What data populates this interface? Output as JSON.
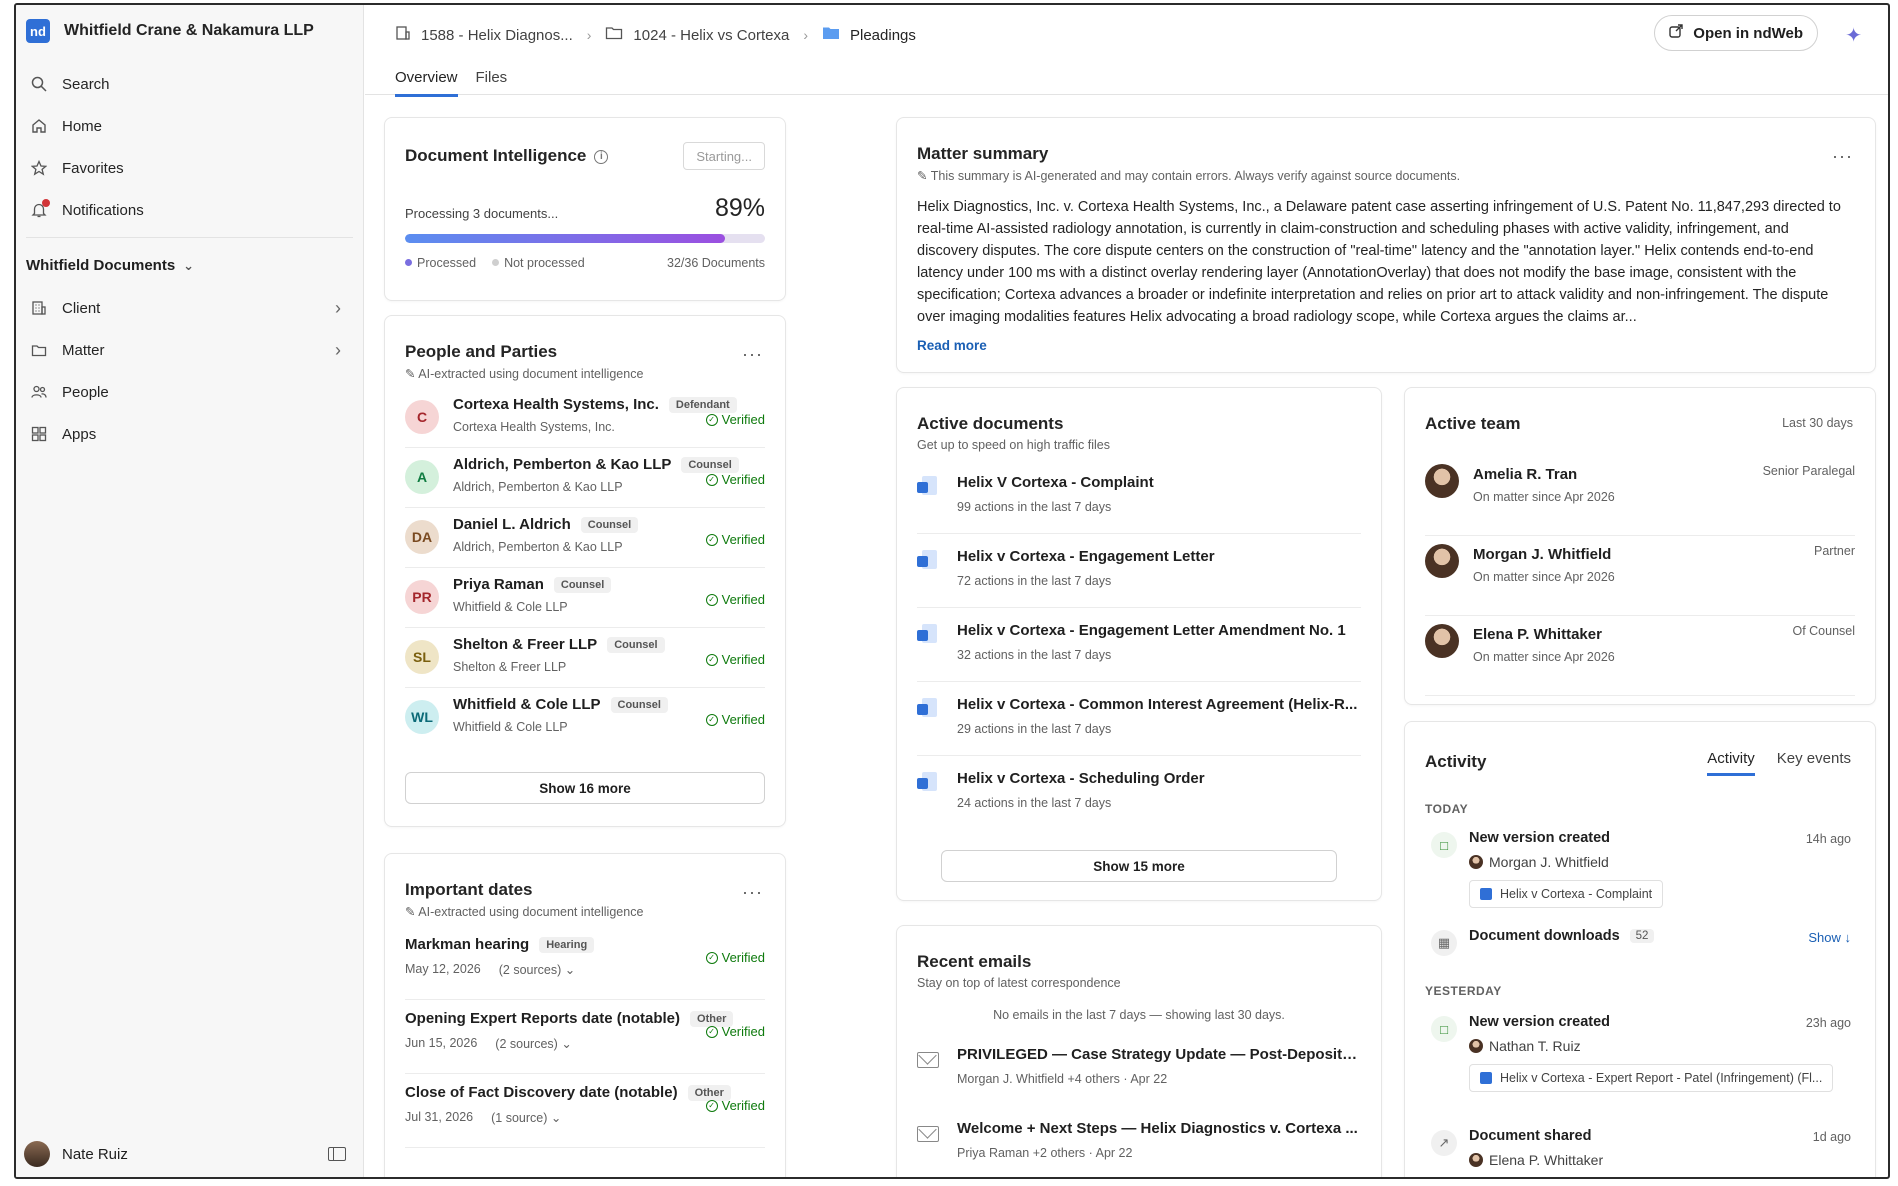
{
  "brand": {
    "logo_text": "nd",
    "name": "Whitfield Crane & Nakamura LLP"
  },
  "sidebar": {
    "items": [
      {
        "label": "Search",
        "icon": "search-icon"
      },
      {
        "label": "Home",
        "icon": "home-icon"
      },
      {
        "label": "Favorites",
        "icon": "star-icon"
      },
      {
        "label": "Notifications",
        "icon": "bell-icon"
      }
    ],
    "section_title": "Whitfield Documents",
    "section_items": [
      {
        "label": "Client",
        "icon": "building-icon"
      },
      {
        "label": "Matter",
        "icon": "folder-icon"
      },
      {
        "label": "People",
        "icon": "people-icon"
      },
      {
        "label": "Apps",
        "icon": "apps-icon"
      }
    ],
    "user_name": "Nate Ruiz"
  },
  "header": {
    "breadcrumbs": [
      "1588 - Helix Diagnos...",
      "1024 - Helix vs Cortexa",
      "Pleadings"
    ],
    "open_button": "Open in ndWeb",
    "tabs": [
      "Overview",
      "Files"
    ]
  },
  "doc_intel": {
    "title": "Document Intelligence",
    "status_button": "Starting...",
    "processing_text": "Processing 3 documents...",
    "percent_text": "89%",
    "progress": 0.89,
    "legend_processed": "Processed",
    "legend_not_processed": "Not processed",
    "count_text": "32/36 Documents",
    "colors": {
      "bar_start": "#5b8ef0",
      "bar_end": "#9b4fe0"
    }
  },
  "people": {
    "title": "People and Parties",
    "subtitle": "AI-extracted using document intelligence",
    "verified_label": "Verified",
    "rows": [
      {
        "initials": "C",
        "name": "Cortexa Health Systems, Inc.",
        "tag": "Defendant",
        "org": "Cortexa Health Systems, Inc.",
        "bg": "#f6d5d5",
        "fg": "#a4262c"
      },
      {
        "initials": "A",
        "name": "Aldrich, Pemberton & Kao LLP",
        "tag": "Counsel",
        "org": "Aldrich, Pemberton & Kao LLP",
        "bg": "#d4f0dc",
        "fg": "#107c41"
      },
      {
        "initials": "DA",
        "name": "Daniel L. Aldrich",
        "tag": "Counsel",
        "org": "Aldrich, Pemberton & Kao LLP",
        "bg": "#ecdccd",
        "fg": "#7a4a21"
      },
      {
        "initials": "PR",
        "name": "Priya Raman",
        "tag": "Counsel",
        "org": "Whitfield & Cole LLP",
        "bg": "#f6d5d5",
        "fg": "#a4262c"
      },
      {
        "initials": "SL",
        "name": "Shelton & Freer LLP",
        "tag": "Counsel",
        "org": "Shelton & Freer LLP",
        "bg": "#efe5c6",
        "fg": "#7a5f0e"
      },
      {
        "initials": "WL",
        "name": "Whitfield & Cole LLP",
        "tag": "Counsel",
        "org": "Whitfield & Cole LLP",
        "bg": "#cdeef0",
        "fg": "#0b6a77"
      }
    ],
    "show_more": "Show 16 more"
  },
  "dates": {
    "title": "Important dates",
    "subtitle": "AI-extracted using document intelligence",
    "verified_label": "Verified",
    "rows": [
      {
        "name": "Markman hearing",
        "tag": "Hearing",
        "date": "May 12, 2026",
        "sources": "(2 sources)"
      },
      {
        "name": "Opening Expert Reports date (notable)",
        "tag": "Other",
        "date": "Jun 15, 2026",
        "sources": "(2 sources)"
      },
      {
        "name": "Close of Fact Discovery date (notable)",
        "tag": "Other",
        "date": "Jul 31, 2026",
        "sources": "(1 source)"
      }
    ]
  },
  "summary": {
    "title": "Matter summary",
    "disclaimer": "This summary is AI-generated and may contain errors. Always verify against source documents.",
    "text": "Helix Diagnostics, Inc. v. Cortexa Health Systems, Inc., a Delaware patent case asserting infringement of U.S. Patent No. 11,847,293 directed to real-time AI-assisted radiology annotation, is currently in claim-construction and scheduling phases with active validity, infringement, and discovery disputes. The core dispute centers on the construction of \"real-time\" latency and the \"annotation layer.\" Helix contends end-to-end latency under 100 ms with a distinct overlay rendering layer (AnnotationOverlay) that does not modify the base image, consistent with the specification; Cortexa advances a broader or indefinite interpretation and relies on prior art to attack validity and non-infringement. The dispute over imaging modalities features Helix advocating a broad radiology scope, while Cortexa argues the claims ar...",
    "read_more": "Read more"
  },
  "active_docs": {
    "title": "Active documents",
    "subtitle": "Get up to speed on high traffic files",
    "rows": [
      {
        "name": "Helix V Cortexa - Complaint",
        "meta": "99 actions in the last 7 days"
      },
      {
        "name": "Helix v Cortexa - Engagement Letter",
        "meta": "72 actions in the last 7 days"
      },
      {
        "name": "Helix v Cortexa - Engagement Letter Amendment No. 1",
        "meta": "32 actions in the last 7 days"
      },
      {
        "name": "Helix v Cortexa - Common Interest Agreement (Helix-R...",
        "meta": "29 actions in the last 7 days"
      },
      {
        "name": "Helix v Cortexa - Scheduling Order",
        "meta": "24 actions in the last 7 days"
      }
    ],
    "show_more": "Show 15 more"
  },
  "emails": {
    "title": "Recent emails",
    "subtitle": "Stay on top of latest correspondence",
    "notice": "No emails in the last 7 days — showing last 30 days.",
    "rows": [
      {
        "subject": "PRIVILEGED — Case Strategy Update — Post-Depositio...",
        "meta": "Morgan J. Whitfield +4 others · Apr 22"
      },
      {
        "subject": "Welcome + Next Steps — Helix Diagnostics v. Cortexa ...",
        "meta": "Priya Raman +2 others · Apr 22"
      }
    ]
  },
  "team": {
    "title": "Active team",
    "range": "Last 30 days",
    "members": [
      {
        "name": "Amelia R. Tran",
        "since": "On matter since Apr 2026",
        "role": "Senior Paralegal"
      },
      {
        "name": "Morgan J. Whitfield",
        "since": "On matter since Apr 2026",
        "role": "Partner"
      },
      {
        "name": "Elena P. Whittaker",
        "since": "On matter since Apr 2026",
        "role": "Of Counsel"
      }
    ]
  },
  "activity": {
    "title": "Activity",
    "tabs": [
      "Activity",
      "Key events"
    ],
    "today_label": "TODAY",
    "yesterday_label": "YESTERDAY",
    "e1": {
      "title": "New version created",
      "time": "14h ago",
      "who": "Morgan J. Whitfield",
      "file": "Helix v Cortexa - Complaint"
    },
    "e2": {
      "title": "Document downloads",
      "count": "52",
      "show": "Show ↓"
    },
    "e3": {
      "title": "New version created",
      "time": "23h ago",
      "who": "Nathan T. Ruiz",
      "file": "Helix v Cortexa - Expert Report - Patel (Infringement) (Fl..."
    },
    "e4": {
      "title": "Document shared",
      "time": "1d ago",
      "who": "Elena P. Whittaker"
    }
  }
}
